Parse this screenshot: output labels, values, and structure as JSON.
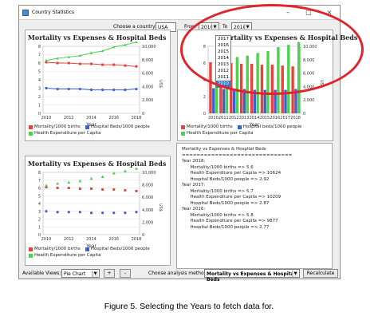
{
  "window": {
    "title": "Country Statistics",
    "controls": [
      "–",
      "□",
      "×"
    ]
  },
  "topbar": {
    "country_label": "Choose a country:",
    "country_value": "USA",
    "from_label": "From",
    "from_value": "2010",
    "to_label": "To",
    "to_value": "2018"
  },
  "year_list": [
    "2017",
    "2016",
    "2015",
    "2014",
    "2013",
    "2012",
    "2011",
    "2010"
  ],
  "year_list_selected": "2010",
  "line_chart": {
    "title": "Mortality vs Expenses & Hospital Beds",
    "x_ticks": [
      "2010",
      "2012",
      "2014",
      "2016",
      "2018"
    ],
    "x_label": "Year",
    "left_ticks": [
      "0",
      "1",
      "2",
      "3",
      "4",
      "5",
      "6",
      "7",
      "8"
    ],
    "right_ticks": [
      "0",
      "2,000",
      "4,000",
      "6,000",
      "8,000",
      "10,000"
    ],
    "right_label": "US$",
    "legend": [
      "Mortality/1000 births",
      "Hospital Beds/1000 people",
      "Health Expenditure per Capita"
    ]
  },
  "bar_chart": {
    "title": "Mortality vs Expenses & Hospital Beds",
    "x_ticks": [
      "2010",
      "2011",
      "2012",
      "2013",
      "2014",
      "2015",
      "2016",
      "2017",
      "2018"
    ],
    "x_label": "Year",
    "left_ticks": [
      "0",
      "2",
      "4",
      "6",
      "8"
    ],
    "right_ticks": [
      "0",
      "2,000",
      "4,000",
      "6,000",
      "8,000",
      "10,000"
    ],
    "right_label": "US$",
    "legend": [
      "Mortality/1000 births",
      "Hospital beds/1000 people",
      "Health Expenditure per Capita"
    ]
  },
  "scatter_chart": {
    "title": "Mortality vs Expenses & Hospital Beds",
    "x_ticks": [
      "2010",
      "2012",
      "2014",
      "2016",
      "2018"
    ],
    "x_label": "Year",
    "left_ticks": [
      "0",
      "1",
      "2",
      "3",
      "4",
      "5",
      "6",
      "7",
      "8"
    ],
    "right_ticks": [
      "0",
      "2,000",
      "4,000",
      "6,000",
      "8,000",
      "10,000"
    ],
    "right_label": "US$",
    "legend": [
      "Mortality/1000 births",
      "Hospital Beds/1000 people",
      "Health Expenditure per Capita"
    ]
  },
  "chart_data": [
    {
      "type": "line",
      "title": "Mortality vs Expenses & Hospital Beds",
      "xlabel": "Year",
      "x": [
        2010,
        2011,
        2012,
        2013,
        2014,
        2015,
        2016,
        2017,
        2018
      ],
      "series": [
        {
          "name": "Mortality/1000 births",
          "axis": "left",
          "color": "#e8423c",
          "values": [
            6.1,
            6.0,
            6.0,
            5.9,
            5.9,
            5.8,
            5.8,
            5.7,
            5.6
          ]
        },
        {
          "name": "Hospital Beds/1000 people",
          "axis": "left",
          "color": "#3d5fd6",
          "values": [
            3.0,
            2.9,
            2.9,
            2.9,
            2.8,
            2.8,
            2.8,
            2.8,
            2.9
          ]
        },
        {
          "name": "Health Expenditure per Capita",
          "axis": "right",
          "color": "#4cd24c",
          "values": [
            7900,
            8200,
            8400,
            8600,
            9000,
            9300,
            9877,
            10209,
            10624
          ]
        }
      ],
      "ylim_left": [
        0,
        8
      ],
      "ylim_right": [
        0,
        10000
      ]
    },
    {
      "type": "bar",
      "title": "Mortality vs Expenses & Hospital Beds",
      "xlabel": "Year",
      "categories": [
        "2010",
        "2011",
        "2012",
        "2013",
        "2014",
        "2015",
        "2016",
        "2017",
        "2018"
      ],
      "series": [
        {
          "name": "Mortality/1000 births",
          "axis": "left",
          "color": "#e8423c",
          "values": [
            6.1,
            6.0,
            6.0,
            5.9,
            5.9,
            5.8,
            5.8,
            5.7,
            5.6
          ]
        },
        {
          "name": "Hospital beds/1000 people",
          "axis": "left",
          "color": "#3d5fd6",
          "values": [
            3.0,
            2.9,
            2.9,
            2.9,
            2.8,
            2.8,
            2.8,
            2.8,
            2.9
          ]
        },
        {
          "name": "Health Expenditure per Capita",
          "axis": "right",
          "color": "#4cd24c",
          "values": [
            7900,
            8200,
            8400,
            8600,
            9000,
            9300,
            9877,
            10209,
            10624
          ]
        }
      ],
      "ylim_left": [
        0,
        8
      ],
      "ylim_right": [
        0,
        10000
      ]
    },
    {
      "type": "scatter",
      "title": "Mortality vs Expenses & Hospital Beds",
      "xlabel": "Year",
      "x": [
        2010,
        2011,
        2012,
        2013,
        2014,
        2015,
        2016,
        2017,
        2018
      ],
      "series": [
        {
          "name": "Mortality/1000 births",
          "axis": "left",
          "color": "#e8423c",
          "values": [
            6.1,
            6.0,
            6.0,
            5.9,
            5.9,
            5.8,
            5.8,
            5.7,
            5.6
          ]
        },
        {
          "name": "Hospital Beds/1000 people",
          "axis": "left",
          "color": "#3d5fd6",
          "values": [
            3.0,
            2.9,
            2.9,
            2.9,
            2.8,
            2.8,
            2.8,
            2.8,
            2.9
          ]
        },
        {
          "name": "Health Expenditure per Capita",
          "axis": "right",
          "color": "#4cd24c",
          "values": [
            7900,
            8200,
            8400,
            8600,
            9000,
            9300,
            9877,
            10209,
            10624
          ]
        }
      ],
      "ylim_left": [
        0,
        8
      ],
      "ylim_right": [
        0,
        10000
      ]
    }
  ],
  "report": {
    "lines": [
      "Mortality vs Expenses & Hospital Beds",
      "==============================",
      "Year 2018:",
      "      Mortality/1000 births => 5.6",
      "      Health Expenditure per Capita => 10624",
      "      Hospital Beds/1000 people => 2.92",
      "",
      "Year 2017:",
      "      Mortality/1000 births => 5.7",
      "      Health Expenditure per Capita => 10209",
      "      Hospital Beds/1000 people => 2.87",
      "",
      "Year 2016:",
      "      Mortality/1000 births => 5.8",
      "      Health Expenditure per Capita => 9877",
      "      Hospital Beds/1000 people => 2.77"
    ]
  },
  "bottombar": {
    "views_label": "Available Views:",
    "views_value": "Pie Chart",
    "add_label": "+",
    "remove_label": "-",
    "method_label": "Choose analysis method:",
    "method_value": "Mortality vs Expenses & Hospital Beds",
    "recalc_label": "Recalculate"
  },
  "caption": "Figure 5. Selecting the Years to fetch data for."
}
